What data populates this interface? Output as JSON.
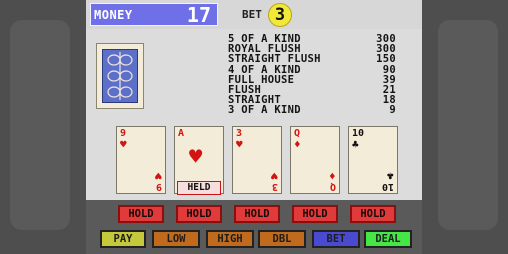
{
  "money": {
    "label": "MONEY",
    "value": "17"
  },
  "bet": {
    "label": "BET",
    "value": "3"
  },
  "paytable": [
    {
      "hand": "5 OF A KIND",
      "payout": "300"
    },
    {
      "hand": "ROYAL FLUSH",
      "payout": "300"
    },
    {
      "hand": "STRAIGHT FLUSH",
      "payout": "150"
    },
    {
      "hand": "4 OF A KIND",
      "payout": "90"
    },
    {
      "hand": "FULL HOUSE",
      "payout": "39"
    },
    {
      "hand": "FLUSH",
      "payout": "21"
    },
    {
      "hand": "STRAIGHT",
      "payout": "18"
    },
    {
      "hand": "3 OF A KIND",
      "payout": "9"
    }
  ],
  "cards": [
    {
      "rank": "9",
      "suit": "♥",
      "color": "red",
      "held": false
    },
    {
      "rank": "A",
      "suit": "♥",
      "color": "red",
      "held": true,
      "held_label": "HELD"
    },
    {
      "rank": "3",
      "suit": "♥",
      "color": "red",
      "held": false
    },
    {
      "rank": "Q",
      "suit": "♦",
      "color": "red",
      "held": false
    },
    {
      "rank": "10",
      "suit": "♣",
      "color": "black",
      "held": false
    }
  ],
  "hold_buttons": [
    "HOLD",
    "HOLD",
    "HOLD",
    "HOLD",
    "HOLD"
  ],
  "actions": [
    {
      "label": "PAY",
      "color": "#c4c83a"
    },
    {
      "label": "LOW",
      "color": "#c06a1e"
    },
    {
      "label": "HIGH",
      "color": "#c06a1e"
    },
    {
      "label": "DBL",
      "color": "#c06a1e"
    },
    {
      "label": "BET",
      "color": "#4a4ad0"
    },
    {
      "label": "DEAL",
      "color": "#46e646"
    }
  ]
}
